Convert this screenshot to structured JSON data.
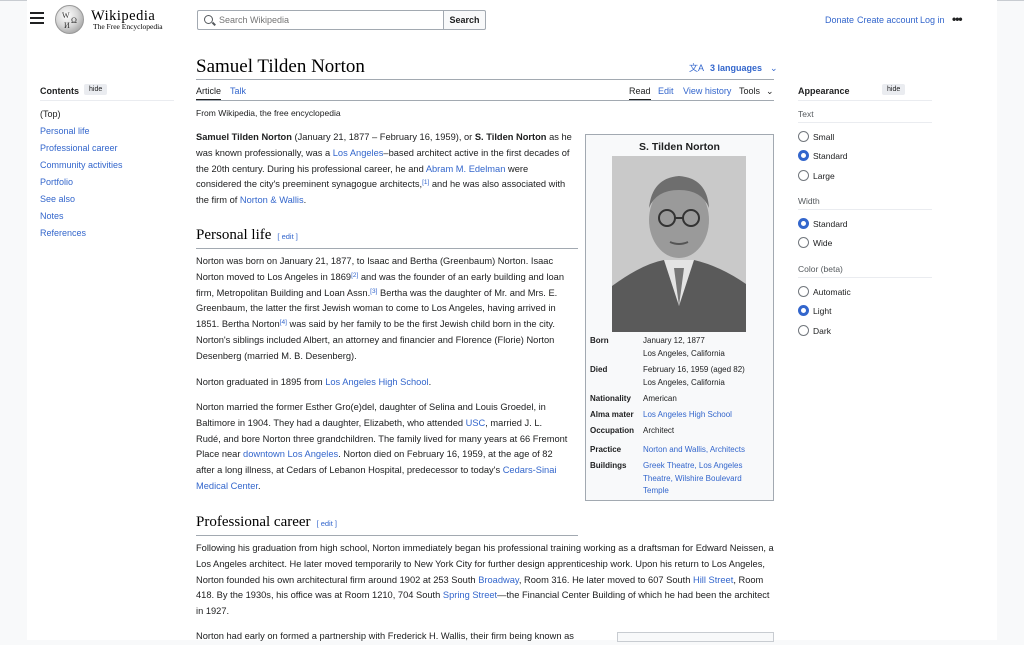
{
  "header": {
    "logo_wordmark": "Wikipedia",
    "logo_tagline": "The Free Encyclopedia",
    "search_placeholder": "Search Wikipedia",
    "search_button": "Search",
    "donate": "Donate",
    "create_account": "Create account",
    "log_in": "Log in",
    "more": "•••"
  },
  "toc": {
    "title": "Contents",
    "hide": "hide",
    "items": [
      "(Top)",
      "Personal life",
      "Professional career",
      "Community activities",
      "Portfolio",
      "See also",
      "Notes",
      "References"
    ]
  },
  "article": {
    "title": "Samuel Tilden Norton",
    "languages": "3 languages",
    "tabs": {
      "article": "Article",
      "talk": "Talk",
      "read": "Read",
      "edit": "Edit",
      "history": "View history",
      "tools": "Tools"
    },
    "from": "From Wikipedia, the free encyclopedia",
    "edit_label": "edit",
    "sections": {
      "personal": "Personal life",
      "professional": "Professional career"
    }
  },
  "infobox": {
    "title": "S. Tilden Norton",
    "rows": [
      {
        "label": "Born",
        "value": "January 12, 1877",
        "value2": "Los Angeles, California"
      },
      {
        "label": "Died",
        "value": "February 16, 1959 (aged 82)",
        "value2": "Los Angeles, California"
      },
      {
        "label": "Nationality",
        "value": "American"
      },
      {
        "label": "Alma mater",
        "value": "Los Angeles High School"
      },
      {
        "label": "Occupation",
        "value": "Architect"
      },
      {
        "label": "Practice",
        "value": "Norton and Wallis, Architects"
      },
      {
        "label": "Buildings",
        "value": "Greek Theatre, Los Angeles Theatre, Wilshire Boulevard Temple"
      }
    ]
  },
  "appearance": {
    "title": "Appearance",
    "hide": "hide",
    "text_label": "Text",
    "text_options": [
      "Small",
      "Standard",
      "Large"
    ],
    "width_label": "Width",
    "width_options": [
      "Standard",
      "Wide"
    ],
    "color_label": "Color (beta)",
    "color_options": [
      "Automatic",
      "Light",
      "Dark"
    ],
    "selected": {
      "text": "Standard",
      "width": "Standard",
      "color": "Light"
    }
  },
  "colors": {
    "link": "#3366cc",
    "text": "#202122",
    "border": "#a2a9b1"
  }
}
